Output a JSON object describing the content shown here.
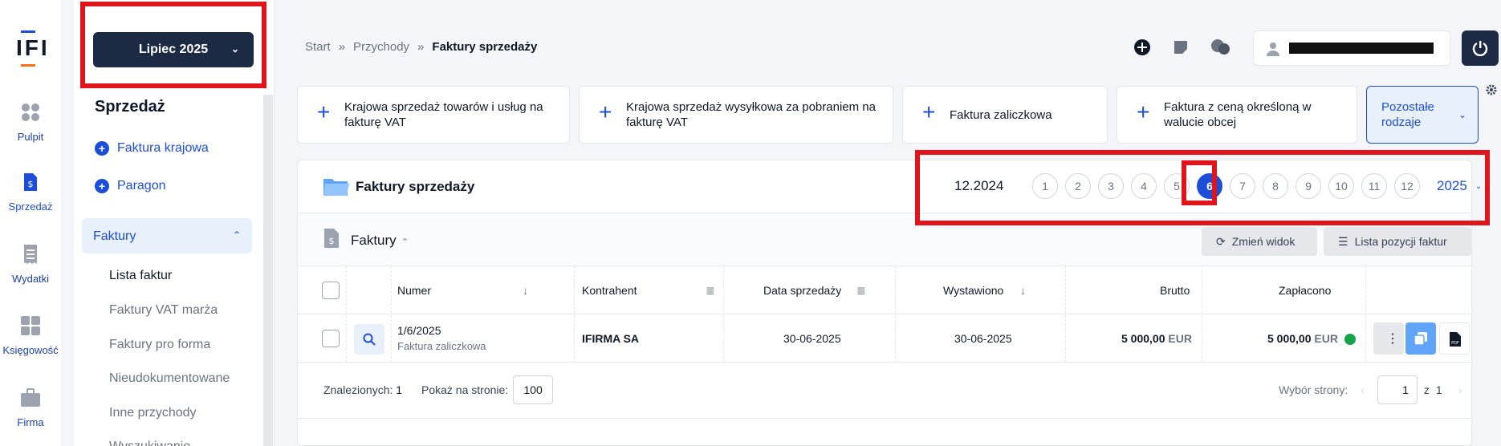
{
  "brand": {
    "logo_text": "IFI",
    "accent": "#1d4ed8",
    "dark": "#1c2a44",
    "highlight": "#e0141b"
  },
  "rail": [
    {
      "label": "Pulpit",
      "icon": "grid-icon"
    },
    {
      "label": "Sprzedaż",
      "icon": "invoice-dollar-icon"
    },
    {
      "label": "Wydatki",
      "icon": "receipt-icon"
    },
    {
      "label": "Księgowość",
      "icon": "calculator-icon"
    },
    {
      "label": "Firma",
      "icon": "briefcase-icon"
    }
  ],
  "sidebar": {
    "month": "Lipiec 2025",
    "title": "Sprzedaż",
    "links": [
      "Faktura krajowa",
      "Paragon"
    ],
    "group": "Faktury",
    "items": [
      "Lista faktur",
      "Faktury VAT marża",
      "Faktury pro forma",
      "Nieudokumentowane",
      "Inne przychody",
      "Wyszukiwanie"
    ]
  },
  "header": {
    "breadcrumb": [
      "Start",
      "Przychody",
      "Faktury sprzedaży"
    ],
    "separator": "»",
    "icons": [
      "add-circle-icon",
      "note-icon",
      "chat-icon"
    ],
    "power_icon": "power-icon"
  },
  "actions": [
    "Krajowa sprzedaż towarów i usług na fakturę VAT",
    "Krajowa sprzedaż wysyłkowa za pobraniem na fakturę VAT",
    "Faktura zaliczkowa",
    "Faktura z ceną określoną w walucie obcej",
    "Pozostałe rodzaje"
  ],
  "panel": {
    "title": "Faktury sprzedaży",
    "prev_year": "12.2024",
    "months": [
      "1",
      "2",
      "3",
      "4",
      "5",
      "6",
      "7",
      "8",
      "9",
      "10",
      "11",
      "12"
    ],
    "active_month": "6",
    "next_year": "2025",
    "section": "Faktury",
    "btn_change_view": "Zmień widok",
    "btn_positions": "Lista pozycji faktur"
  },
  "table": {
    "columns": [
      "Numer",
      "Kontrahent",
      "Data sprzedaży",
      "Wystawiono",
      "Brutto",
      "Zapłacono"
    ],
    "rows": [
      {
        "numer": "1/6/2025",
        "typ": "Faktura zaliczkowa",
        "kontrahent": "IFIRMA SA",
        "data_sprzedazy": "30-06-2025",
        "wystawiono": "30-06-2025",
        "brutto": "5 000,00",
        "brutto_ccy": "EUR",
        "zaplacono": "5 000,00",
        "zaplacono_ccy": "EUR",
        "status_color": "#16a34a"
      }
    ]
  },
  "footer": {
    "found_label": "Znalezionych:",
    "found_count": "1",
    "per_page_label": "Pokaż na stronie:",
    "per_page": "100",
    "page_label": "Wybór strony:",
    "page": "1",
    "of_label": "z",
    "total_pages": "1"
  }
}
